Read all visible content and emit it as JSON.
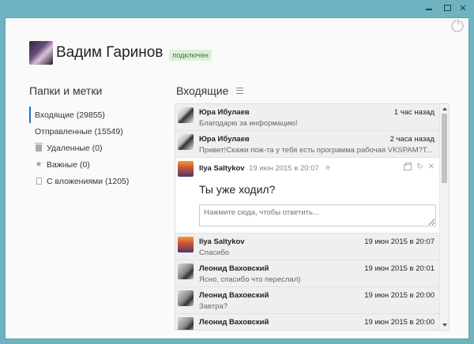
{
  "window": {
    "minimize": "minimize",
    "maximize": "maximize",
    "close": "✕"
  },
  "profile": {
    "name": "Вадим Гаринов",
    "status": "подключен"
  },
  "sidebar": {
    "title": "Папки и метки",
    "items": [
      {
        "label": "Входящие (29855)",
        "icon": ""
      },
      {
        "label": "Отправленные (15549)",
        "icon": ""
      },
      {
        "label": "Удаленные (0)",
        "icon": "trash-icon"
      },
      {
        "label": "Важные (0)",
        "icon": "star-icon"
      },
      {
        "label": "С вложениями (1205)",
        "icon": "document-icon"
      }
    ]
  },
  "inbox": {
    "title": "Входящие",
    "messages": [
      {
        "from": "Юра Ибулаев",
        "time": "1 час назад",
        "snippet": "Благодарю за информацию!"
      },
      {
        "from": "Юра Ибулаев",
        "time": "2 часа назад",
        "snippet": "Привет!Скажи пож-та у тебя есть программа рабочая VKSPAM?Т..."
      },
      {
        "from": "Ilya Saltykov",
        "time": "19 июн 2015 в 20:07",
        "snippet": "Спасибо"
      },
      {
        "from": "Леонид Ваховский",
        "time": "19 июн 2015 в 20:01",
        "snippet": "Ясно, спасибо что переслал)"
      },
      {
        "from": "Леонид Ваховский",
        "time": "19 июн 2015 в 20:00",
        "snippet": "Завтра?"
      },
      {
        "from": "Леонид Ваховский",
        "time": "19 июн 2015 в 20:00",
        "snippet": ""
      }
    ],
    "open": {
      "from": "Ilya Saltykov",
      "date": "19 июн 2015 в 20:07",
      "body": "Ты уже ходил?",
      "reply_placeholder": "Нажмите сюда, чтобы ответить..."
    }
  }
}
